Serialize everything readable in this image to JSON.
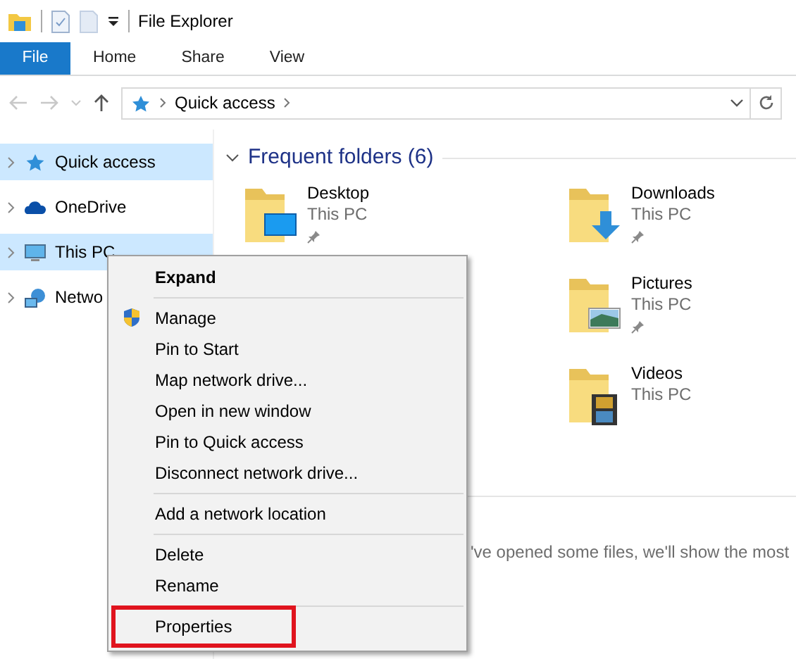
{
  "window": {
    "title": "File Explorer"
  },
  "ribbon_tabs": [
    {
      "label": "File",
      "kind": "menu"
    },
    {
      "label": "Home",
      "kind": "tab"
    },
    {
      "label": "Share",
      "kind": "tab"
    },
    {
      "label": "View",
      "kind": "tab"
    }
  ],
  "address_bar": {
    "crumbs": [
      "Quick access"
    ]
  },
  "navigation": [
    {
      "label": "Quick access",
      "selected": true
    },
    {
      "label": "OneDrive",
      "selected": false
    },
    {
      "label": "This PC",
      "selected": true
    },
    {
      "label": "Netwo",
      "selected": false
    }
  ],
  "frequent_folders": {
    "title": "Frequent folders (6)",
    "folders": [
      {
        "name": "Desktop",
        "location": "This PC",
        "pinned": true
      },
      {
        "name": "Downloads",
        "location": "This PC",
        "pinned": true
      },
      {
        "name": "Pictures",
        "location": "This PC",
        "pinned": true
      },
      {
        "name": "Videos",
        "location": "This PC",
        "pinned": false
      }
    ]
  },
  "recent_files": {
    "message": "'ve opened some files, we'll show the most"
  },
  "context_menu": {
    "items": [
      {
        "kind": "item",
        "label": "Expand",
        "bold": true,
        "shield": false,
        "outlined": false
      },
      {
        "kind": "separator"
      },
      {
        "kind": "item",
        "label": "Manage",
        "bold": false,
        "shield": true,
        "outlined": false
      },
      {
        "kind": "item",
        "label": "Pin to Start",
        "bold": false,
        "shield": false,
        "outlined": false
      },
      {
        "kind": "item",
        "label": "Map network drive...",
        "bold": false,
        "shield": false,
        "outlined": false
      },
      {
        "kind": "item",
        "label": "Open in new window",
        "bold": false,
        "shield": false,
        "outlined": false
      },
      {
        "kind": "item",
        "label": "Pin to Quick access",
        "bold": false,
        "shield": false,
        "outlined": false
      },
      {
        "kind": "item",
        "label": "Disconnect network drive...",
        "bold": false,
        "shield": false,
        "outlined": false
      },
      {
        "kind": "separator"
      },
      {
        "kind": "item",
        "label": "Add a network location",
        "bold": false,
        "shield": false,
        "outlined": false
      },
      {
        "kind": "separator"
      },
      {
        "kind": "item",
        "label": "Delete",
        "bold": false,
        "shield": false,
        "outlined": false
      },
      {
        "kind": "item",
        "label": "Rename",
        "bold": false,
        "shield": false,
        "outlined": false
      },
      {
        "kind": "separator"
      },
      {
        "kind": "item",
        "label": "Properties",
        "bold": false,
        "shield": false,
        "outlined": true
      }
    ]
  }
}
